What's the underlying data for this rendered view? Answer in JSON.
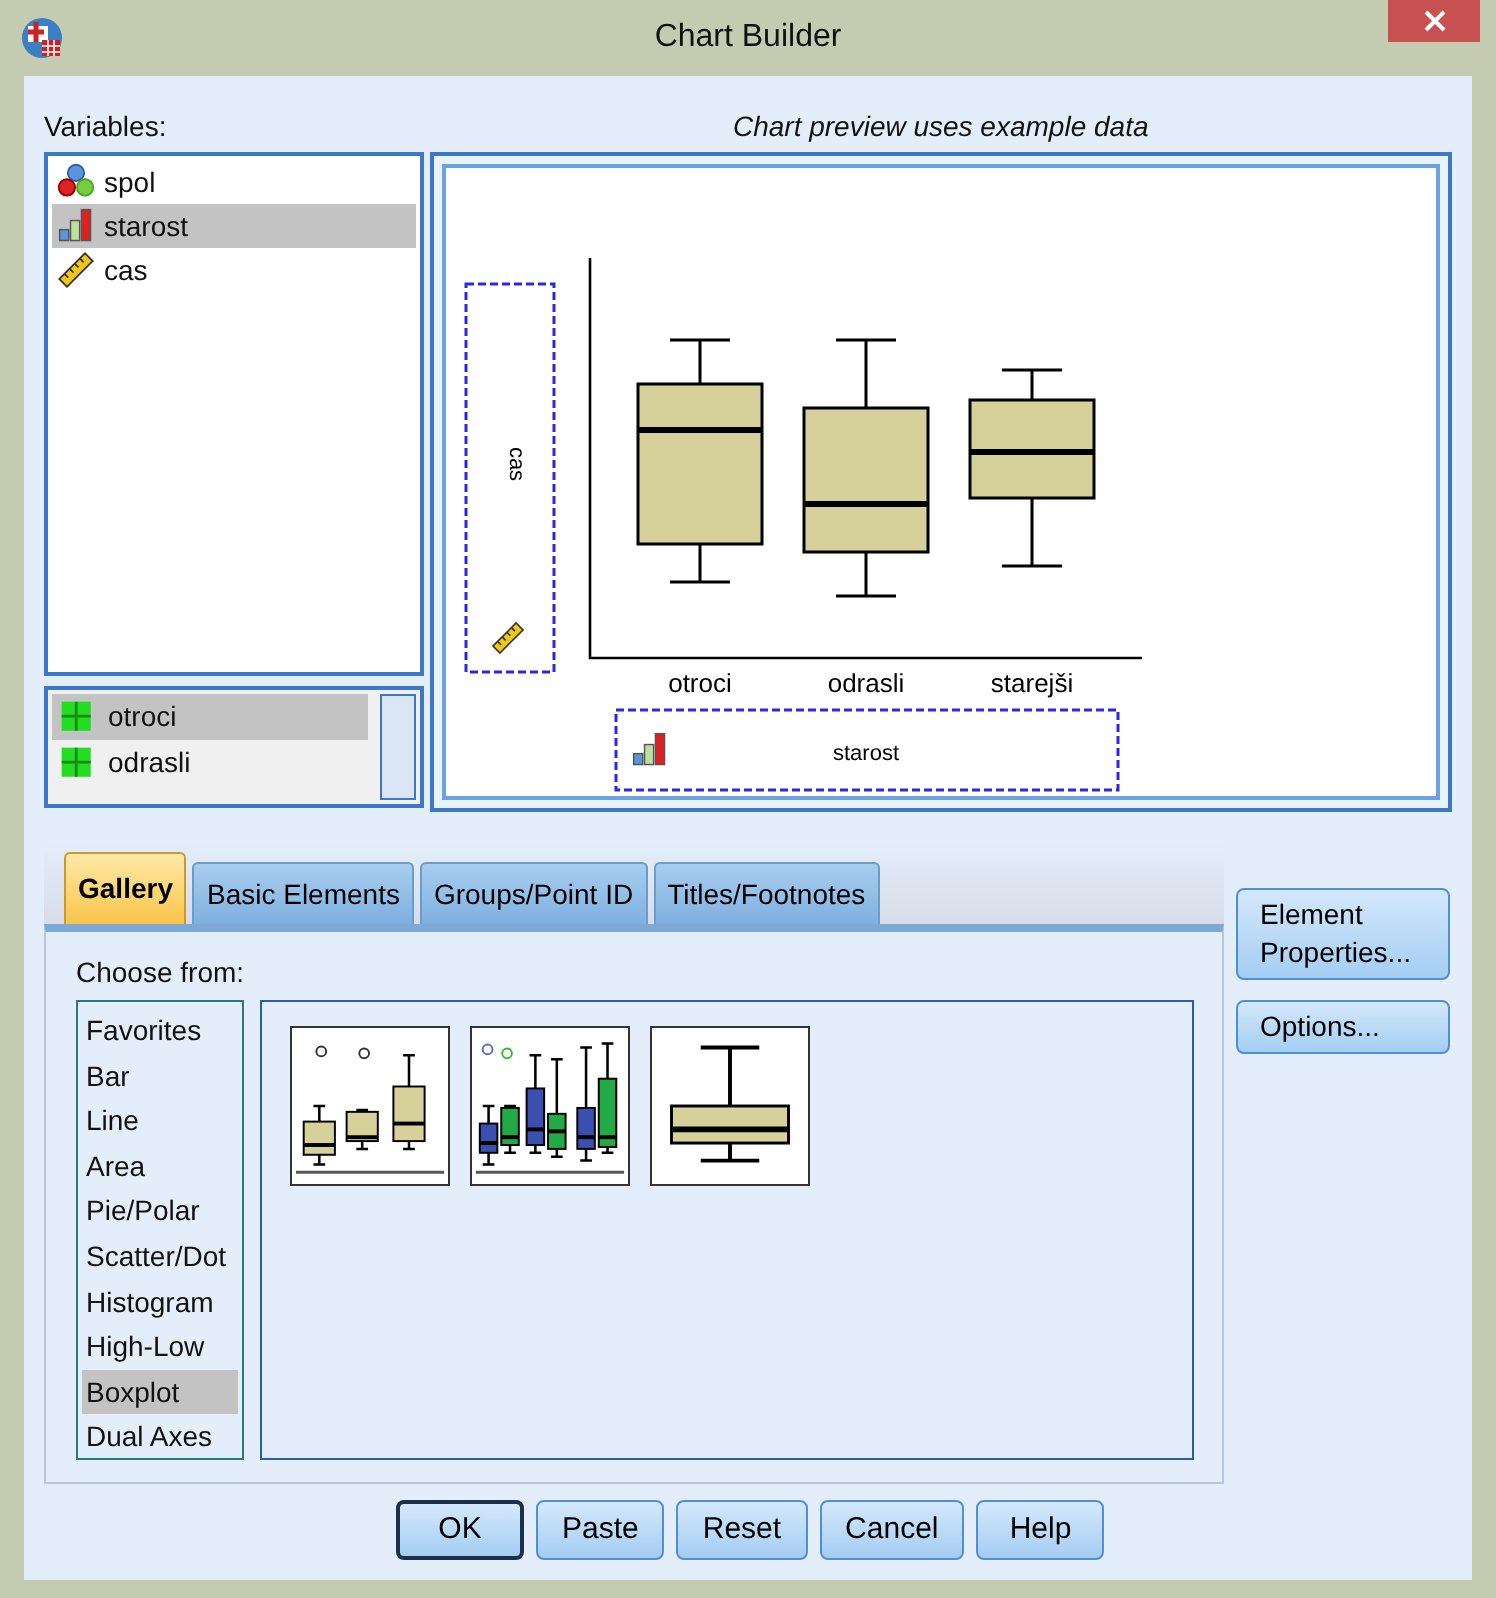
{
  "window": {
    "title": "Chart Builder"
  },
  "variables": {
    "label": "Variables:",
    "items": [
      {
        "name": "spol",
        "kind": "nominal",
        "selected": false
      },
      {
        "name": "starost",
        "kind": "ordinal",
        "selected": true
      },
      {
        "name": "cas",
        "kind": "scale",
        "selected": false
      }
    ]
  },
  "categories": {
    "items": [
      {
        "label": "otroci",
        "selected": true
      },
      {
        "label": "odrasli",
        "selected": false
      }
    ]
  },
  "preview": {
    "caption": "Chart preview uses example data",
    "y_drop_zone": {
      "label": "cas",
      "kind": "scale"
    },
    "x_drop_zone": {
      "label": "starost",
      "kind": "ordinal"
    },
    "x_categories": [
      "otroci",
      "odrasli",
      "starejši"
    ]
  },
  "tabs": [
    {
      "label": "Gallery",
      "selected": true
    },
    {
      "label": "Basic Elements",
      "selected": false
    },
    {
      "label": "Groups/Point ID",
      "selected": false
    },
    {
      "label": "Titles/Footnotes",
      "selected": false
    }
  ],
  "gallery": {
    "label": "Choose from:",
    "types": [
      {
        "label": "Favorites",
        "selected": false
      },
      {
        "label": "Bar",
        "selected": false
      },
      {
        "label": "Line",
        "selected": false
      },
      {
        "label": "Area",
        "selected": false
      },
      {
        "label": "Pie/Polar",
        "selected": false
      },
      {
        "label": "Scatter/Dot",
        "selected": false
      },
      {
        "label": "Histogram",
        "selected": false
      },
      {
        "label": "High-Low",
        "selected": false
      },
      {
        "label": "Boxplot",
        "selected": true
      },
      {
        "label": "Dual Axes",
        "selected": false
      }
    ],
    "thumbnails": [
      {
        "kind": "simple"
      },
      {
        "kind": "clustered"
      },
      {
        "kind": "single"
      }
    ]
  },
  "side_buttons": [
    "Element Properties...",
    "Options..."
  ],
  "buttons": [
    {
      "label": "OK",
      "default": true
    },
    {
      "label": "Paste",
      "default": false
    },
    {
      "label": "Reset",
      "default": false
    },
    {
      "label": "Cancel",
      "default": false
    },
    {
      "label": "Help",
      "default": false
    }
  ]
}
